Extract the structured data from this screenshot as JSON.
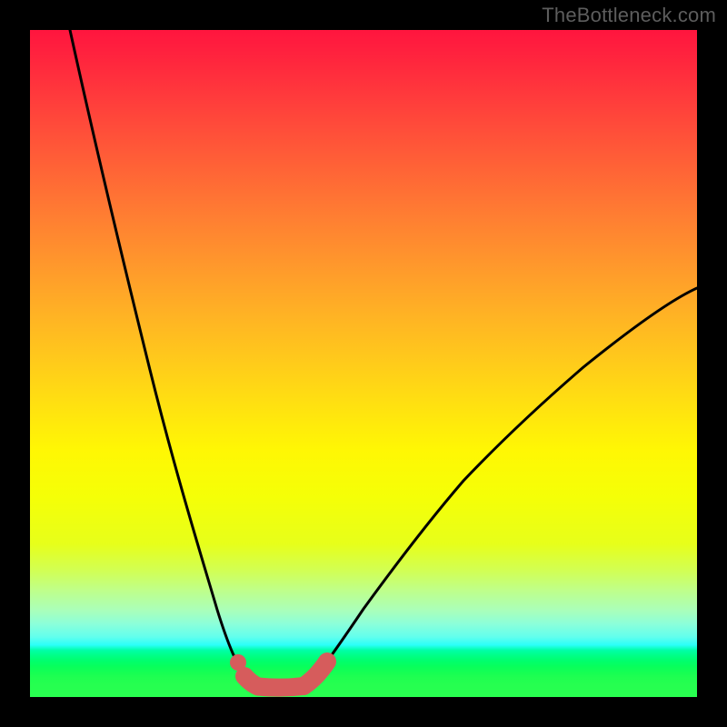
{
  "watermark": "TheBottleneck.com",
  "colors": {
    "curve_stroke": "#000000",
    "marker_stroke": "#d65c5c",
    "marker_fill": "#d65c5c",
    "gradient_top": "#ff153e",
    "gradient_bottom": "#29ff50"
  },
  "chart_data": {
    "type": "line",
    "title": "",
    "xlabel": "",
    "ylabel": "",
    "xlim": [
      0,
      100
    ],
    "ylim": [
      0,
      100
    ],
    "grid": false,
    "series": [
      {
        "name": "bottleneck-curve-left",
        "x": [
          6,
          10,
          14,
          18,
          22,
          26,
          28,
          30,
          31,
          32,
          33,
          34
        ],
        "values": [
          100,
          82,
          65,
          49,
          34,
          20,
          13,
          7.5,
          5.0,
          3.3,
          2.2,
          1.7
        ]
      },
      {
        "name": "bottleneck-curve-right",
        "x": [
          41,
          42,
          44,
          46,
          50,
          55,
          60,
          65,
          70,
          76,
          83,
          90,
          100
        ],
        "values": [
          1.7,
          2.4,
          4.5,
          7.3,
          13.2,
          20.2,
          26.6,
          32.4,
          37.8,
          43.5,
          49.5,
          54.8,
          61.3
        ]
      },
      {
        "name": "bottleneck-floor",
        "x": [
          34,
          36,
          38,
          40,
          41
        ],
        "values": [
          1.7,
          1.3,
          1.3,
          1.4,
          1.7
        ]
      }
    ],
    "markers": [
      {
        "name": "left-dot",
        "x": 31.3,
        "y": 5.0,
        "kind": "dot"
      },
      {
        "name": "left-pill",
        "x_from": 32.0,
        "y_from": 3.3,
        "x_to": 34.0,
        "y_to": 1.7,
        "kind": "pill"
      },
      {
        "name": "floor-pill",
        "x_from": 34.0,
        "y_from": 1.7,
        "x_to": 41.0,
        "y_to": 1.7,
        "kind": "pill"
      },
      {
        "name": "right-pill",
        "x_from": 41.0,
        "y_from": 1.7,
        "x_to": 44.5,
        "y_to": 5.3,
        "kind": "pill"
      }
    ]
  }
}
